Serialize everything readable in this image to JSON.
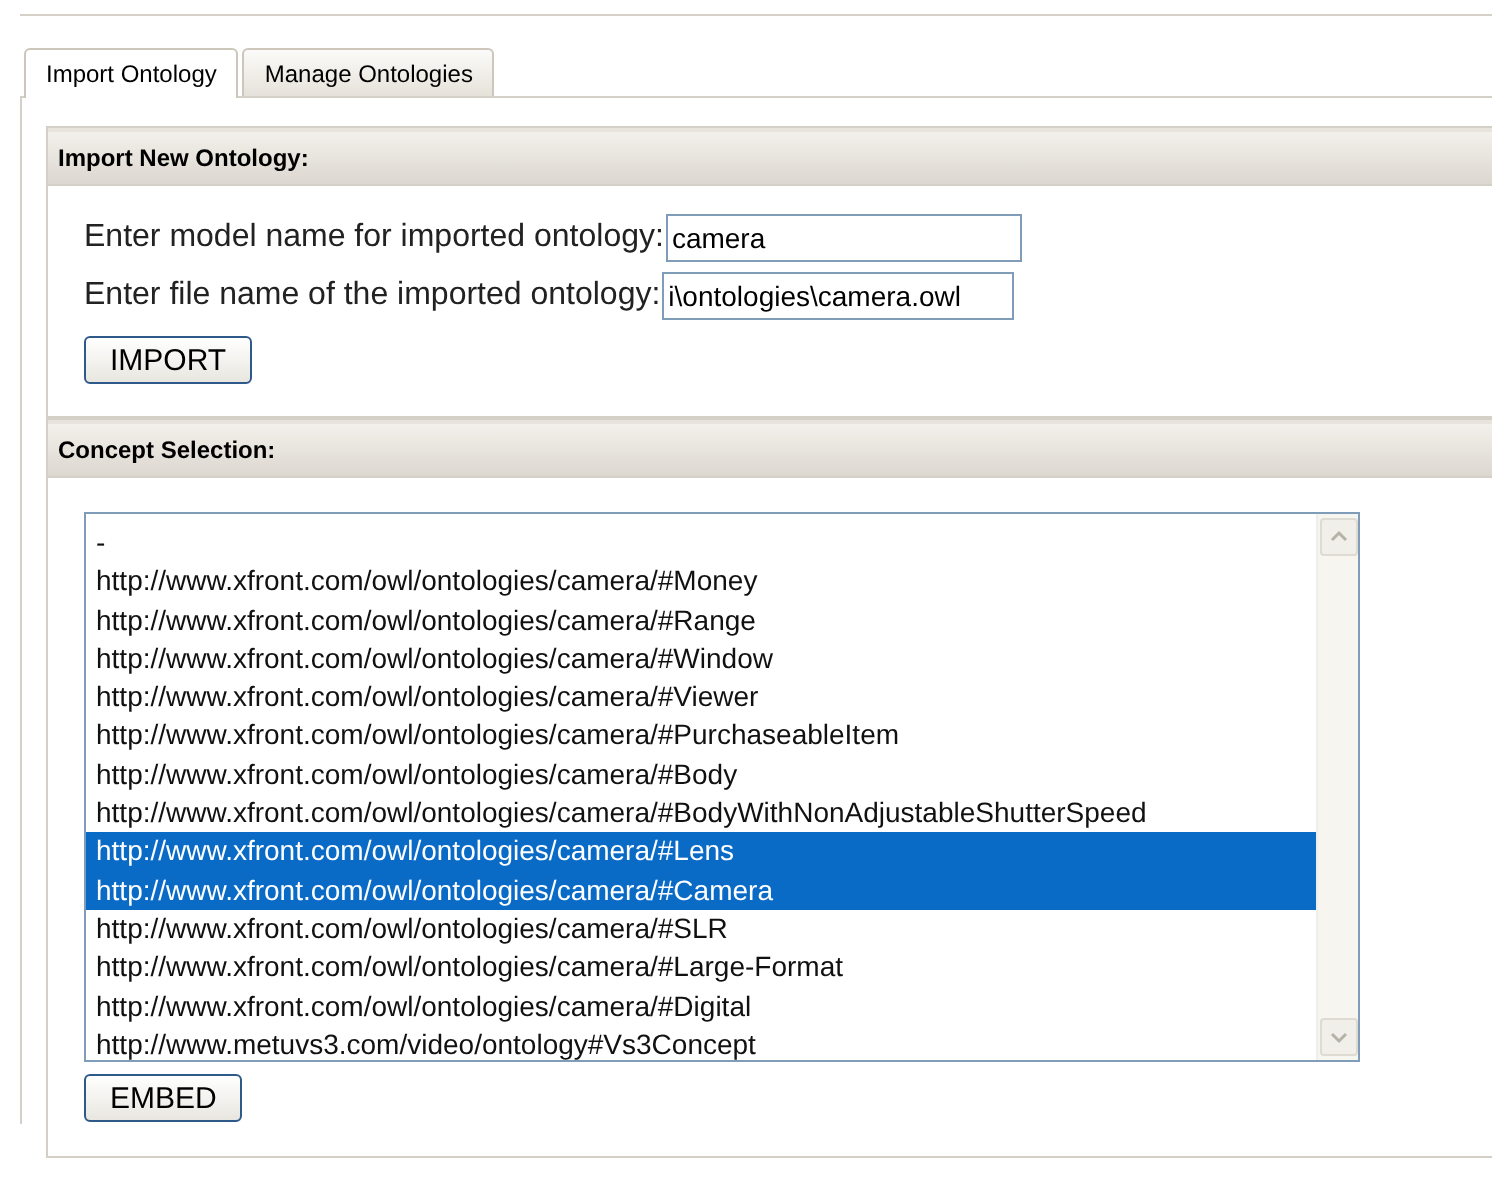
{
  "tabs": [
    {
      "label": "Import Ontology",
      "selected": true
    },
    {
      "label": "Manage Ontologies",
      "selected": false
    }
  ],
  "import_section": {
    "title": "Import New Ontology:",
    "fields": [
      {
        "label": "Enter model name for imported ontology:",
        "value": "camera"
      },
      {
        "label": "Enter file name of the imported ontology:",
        "value": "i\\ontologies\\camera.owl"
      }
    ],
    "button": "IMPORT"
  },
  "concept_section": {
    "title": "Concept Selection:",
    "items": [
      {
        "text": "-",
        "selected": false
      },
      {
        "text": "http://www.xfront.com/owl/ontologies/camera/#Money",
        "selected": false
      },
      {
        "text": "http://www.xfront.com/owl/ontologies/camera/#Range",
        "selected": false
      },
      {
        "text": "http://www.xfront.com/owl/ontologies/camera/#Window",
        "selected": false
      },
      {
        "text": "http://www.xfront.com/owl/ontologies/camera/#Viewer",
        "selected": false
      },
      {
        "text": "http://www.xfront.com/owl/ontologies/camera/#PurchaseableItem",
        "selected": false
      },
      {
        "text": "http://www.xfront.com/owl/ontologies/camera/#Body",
        "selected": false
      },
      {
        "text": "http://www.xfront.com/owl/ontologies/camera/#BodyWithNonAdjustableShutterSpeed",
        "selected": false
      },
      {
        "text": "http://www.xfront.com/owl/ontologies/camera/#Lens",
        "selected": true
      },
      {
        "text": "http://www.xfront.com/owl/ontologies/camera/#Camera",
        "selected": true
      },
      {
        "text": "http://www.xfront.com/owl/ontologies/camera/#SLR",
        "selected": false
      },
      {
        "text": "http://www.xfront.com/owl/ontologies/camera/#Large-Format",
        "selected": false
      },
      {
        "text": "http://www.xfront.com/owl/ontologies/camera/#Digital",
        "selected": false
      },
      {
        "text": "http://www.metuvs3.com/video/ontology#Vs3Concept",
        "selected": false
      }
    ],
    "button": "EMBED"
  }
}
